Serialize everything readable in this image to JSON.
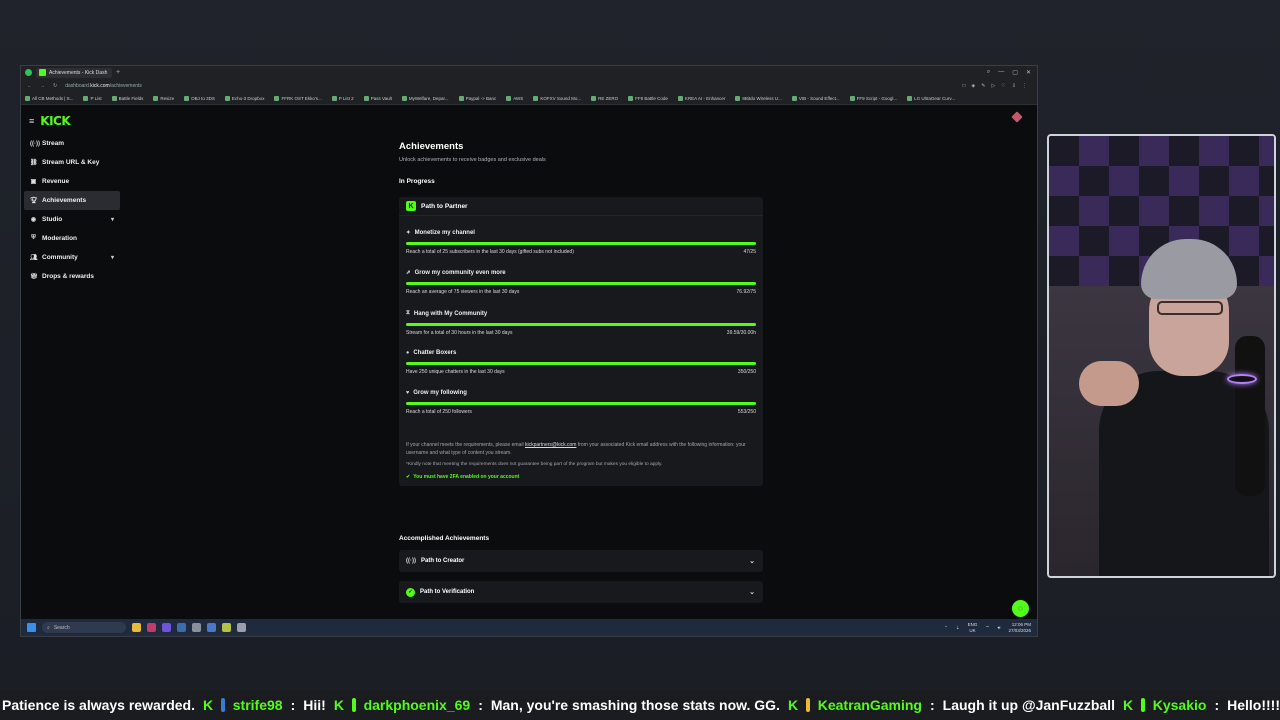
{
  "browser": {
    "tab_title": "Achievements - Kick Dash",
    "url_prefix": "dashboard.",
    "url_host": "kick.com",
    "url_path": "/achievements",
    "bookmarks": [
      "All CB Methods | S...",
      "P List",
      "Battle Fields",
      "Resize",
      "OBJ to 3DS",
      "Echo-3 Dropbox",
      "FFRK OST Ekko's...",
      "P List 2",
      "Pass Vault",
      "MyWelfare, Depar...",
      "Paypal -> Banc",
      "AWS",
      "KOFXV Sound Mo...",
      "RE ZERO",
      "FF8 Battle Code",
      "KREA AI - Enhancer",
      "8Bitdo Wireless U...",
      "VIB - Sound Effect...",
      "FF9 Script - Googl...",
      "LG UltraGear Curv..."
    ]
  },
  "brand": {
    "logo": "KICK",
    "accent": "#53fc18"
  },
  "sidebar": {
    "items": [
      {
        "label": "Stream",
        "icon": "broadcast-icon"
      },
      {
        "label": "Stream URL & Key",
        "icon": "link-icon"
      },
      {
        "label": "Revenue",
        "icon": "wallet-icon"
      },
      {
        "label": "Achievements",
        "icon": "trophy-icon",
        "active": true
      },
      {
        "label": "Studio",
        "icon": "palette-icon",
        "expandable": true
      },
      {
        "label": "Moderation",
        "icon": "shield-icon"
      },
      {
        "label": "Community",
        "icon": "users-icon",
        "expandable": true
      },
      {
        "label": "Drops & rewards",
        "icon": "gift-icon"
      }
    ]
  },
  "main": {
    "title": "Achievements",
    "subtitle": "Unlock achievements to receive badges and exclusive deals",
    "in_progress_heading": "In Progress",
    "path_to_partner": {
      "title": "Path to Partner",
      "requirements": [
        {
          "title": "Monetize my channel",
          "desc": "Reach a total of 25 subscribers in the last 30 days (gifted subs not included)",
          "value": "47/25",
          "progress": 1.0
        },
        {
          "title": "Grow my community even more",
          "desc": "Reach an average of 75 viewers in the last 30 days",
          "value": "76.92/75",
          "progress": 1.0
        },
        {
          "title": "Hang with My Community",
          "desc": "Stream for a total of 30 hours in the last 30 days",
          "value": "39.59/30.00h",
          "progress": 1.0
        },
        {
          "title": "Chatter Boxers",
          "desc": "Have 250 unique chatters in the last 30 days",
          "value": "350/250",
          "progress": 1.0
        },
        {
          "title": "Grow my following",
          "desc": "Reach a total of 250 followers",
          "value": "553/250",
          "progress": 1.0
        }
      ],
      "note_pre": "If your channel meets the requirements, please email ",
      "note_email": "kickpartners@kick.com",
      "note_post": " from your associated Kick email address with the following information: your username and what type of content you stream.",
      "note2": "*Kindly note that meeting the requirements does not guarantee being part of the program but makes you eligible to apply.",
      "tfa": "You must have 2FA enabled on your account"
    },
    "accomplished_heading": "Accomplished Achievements",
    "accomplished": [
      {
        "title": "Path to Creator"
      },
      {
        "title": "Path to Verification"
      }
    ]
  },
  "taskbar": {
    "search_placeholder": "Search",
    "lang": "ENG",
    "region": "UK",
    "time": "12:06 PM",
    "date": "27/03/2026"
  },
  "chat": [
    {
      "user": "",
      "message": "Patience is always rewarded."
    },
    {
      "user": "strife98",
      "message": "Hii!"
    },
    {
      "user": "darkphoenix_69",
      "message": "Man, you're smashing those stats now. GG."
    },
    {
      "user": "KeatranGaming",
      "message": "Laugh it up @JanFuzzball"
    },
    {
      "user": "Kysakio",
      "message": "Hello!!!!"
    }
  ]
}
